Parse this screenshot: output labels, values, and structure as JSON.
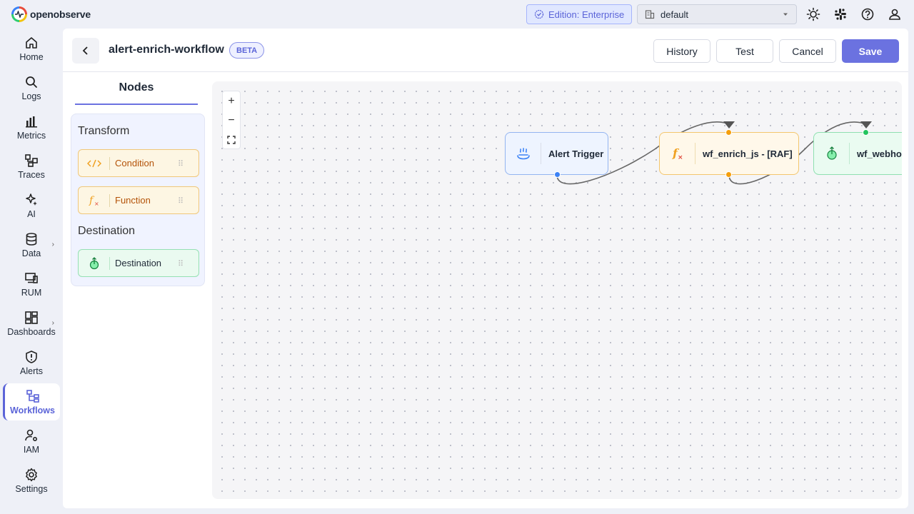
{
  "app": {
    "logo_text": "openobserve"
  },
  "topbar": {
    "edition_label": "Edition: Enterprise",
    "org_value": "default",
    "icons": [
      "sun-icon",
      "slack-icon",
      "help-icon",
      "user-icon"
    ]
  },
  "sidebar": {
    "items": [
      {
        "label": "Home",
        "icon": "home-icon"
      },
      {
        "label": "Logs",
        "icon": "search-icon"
      },
      {
        "label": "Metrics",
        "icon": "bar-chart-icon"
      },
      {
        "label": "Traces",
        "icon": "traces-icon"
      },
      {
        "label": "AI",
        "icon": "sparkle-icon"
      },
      {
        "label": "Data",
        "icon": "database-icon"
      },
      {
        "label": "RUM",
        "icon": "devices-icon"
      },
      {
        "label": "Dashboards",
        "icon": "dashboard-icon"
      },
      {
        "label": "Alerts",
        "icon": "alert-shield-icon"
      },
      {
        "label": "Workflows",
        "icon": "workflow-icon",
        "active": true
      },
      {
        "label": "IAM",
        "icon": "user-gear-icon"
      },
      {
        "label": "Settings",
        "icon": "gear-icon"
      }
    ]
  },
  "header": {
    "title": "alert-enrich-workflow",
    "badge": "BETA",
    "history_label": "History",
    "test_label": "Test",
    "cancel_label": "Cancel",
    "save_label": "Save"
  },
  "nodes_panel": {
    "tab_label": "Nodes",
    "transform_title": "Transform",
    "condition_label": "Condition",
    "function_label": "Function",
    "destination_title": "Destination",
    "destination_label": "Destination"
  },
  "canvas": {
    "zoom_in": "+",
    "zoom_out": "−",
    "nodes": [
      {
        "label": "Alert Trigger",
        "icon": "trigger-icon",
        "color": "#3b82f6"
      },
      {
        "label": "wf_enrich_js - [RAF]",
        "icon": "function-icon",
        "color": "#f59e0b"
      },
      {
        "label": "wf_webhoo",
        "icon": "destination-icon",
        "color": "#22c55e"
      }
    ]
  },
  "colors": {
    "accent": "#6b72e0",
    "function": "#f59e0b",
    "destination": "#22c55e",
    "trigger": "#3b82f6"
  }
}
